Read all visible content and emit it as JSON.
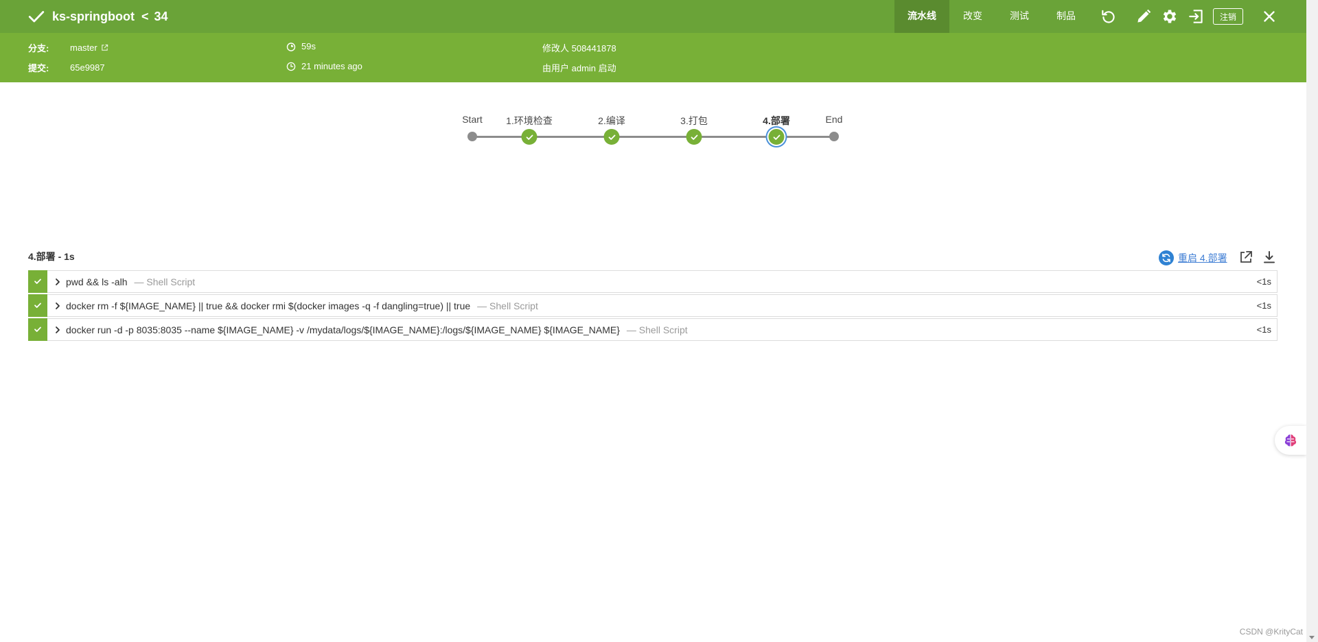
{
  "header": {
    "title": "ks-springboot",
    "chevron": "<",
    "run_number": "34",
    "tabs": [
      {
        "label": "流水线",
        "active": true
      },
      {
        "label": "改变",
        "active": false
      },
      {
        "label": "测试",
        "active": false
      },
      {
        "label": "制品",
        "active": false
      }
    ],
    "icons": [
      "replay-icon",
      "edit-icon",
      "gear-icon",
      "exit-icon"
    ],
    "logout_label": "注销",
    "close_icon": "close-icon"
  },
  "meta": {
    "branch_label": "分支:",
    "branch_value": "master",
    "commit_label": "提交:",
    "commit_value": "65e9987",
    "duration": "59s",
    "time_ago": "21 minutes ago",
    "changes": "修改人 508441878",
    "started_by": "由用户 admin 启动"
  },
  "pipeline": {
    "stages": [
      {
        "label": "Start",
        "kind": "start"
      },
      {
        "label": "1.环境检查",
        "kind": "ok"
      },
      {
        "label": "2.编译",
        "kind": "ok"
      },
      {
        "label": "3.打包",
        "kind": "ok"
      },
      {
        "label": "4.部署",
        "kind": "ok",
        "selected": true
      },
      {
        "label": "End",
        "kind": "end"
      }
    ]
  },
  "steps_section": {
    "header": "4.部署 - 1s",
    "restart_label": "重启 4.部署",
    "steps": [
      {
        "command": "pwd && ls -alh",
        "type": "— Shell Script",
        "duration": "<1s",
        "status": "success"
      },
      {
        "command": "docker rm -f ${IMAGE_NAME} || true && docker rmi $(docker images -q -f dangling=true) || true",
        "type": "— Shell Script",
        "duration": "<1s",
        "status": "success"
      },
      {
        "command": "docker run -d -p 8035:8035 --name ${IMAGE_NAME} -v /mydata/logs/${IMAGE_NAME}:/logs/${IMAGE_NAME} ${IMAGE_NAME}",
        "type": "— Shell Script",
        "duration": "<1s",
        "status": "success"
      }
    ]
  },
  "watermark": "CSDN @KrityCat",
  "colors": {
    "header_bg": "#6aa338",
    "subbar_bg": "#78b037",
    "success": "#78b037",
    "link": "#3f7ed4"
  }
}
